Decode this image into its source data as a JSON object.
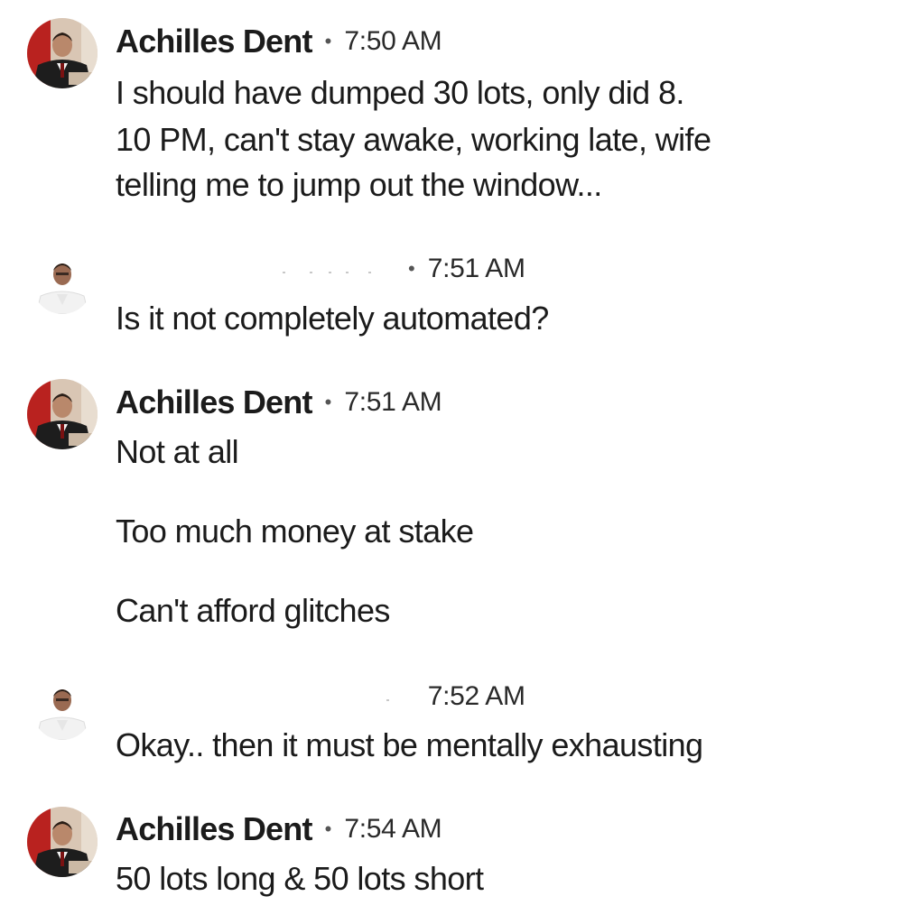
{
  "messages": [
    {
      "author": "Achilles Dent",
      "time": "7:50 AM",
      "lines": [
        "I should have dumped 30 lots, only did 8.",
        "10 PM, can't stay awake, working late, wife",
        "telling me to jump out the window..."
      ]
    },
    {
      "author": "",
      "time": "7:51 AM",
      "lines": [
        "Is it not completely automated?"
      ]
    },
    {
      "author": "Achilles Dent",
      "time": "7:51 AM",
      "lines": [
        "Not at all",
        "Too much money at stake",
        "Can't afford glitches"
      ]
    },
    {
      "author": "",
      "time": "7:52 AM",
      "lines": [
        "Okay.. then it must be mentally exhausting"
      ]
    },
    {
      "author": "Achilles Dent",
      "time": "7:54 AM",
      "lines": [
        "50 lots long & 50 lots short"
      ]
    }
  ],
  "separator": "•"
}
